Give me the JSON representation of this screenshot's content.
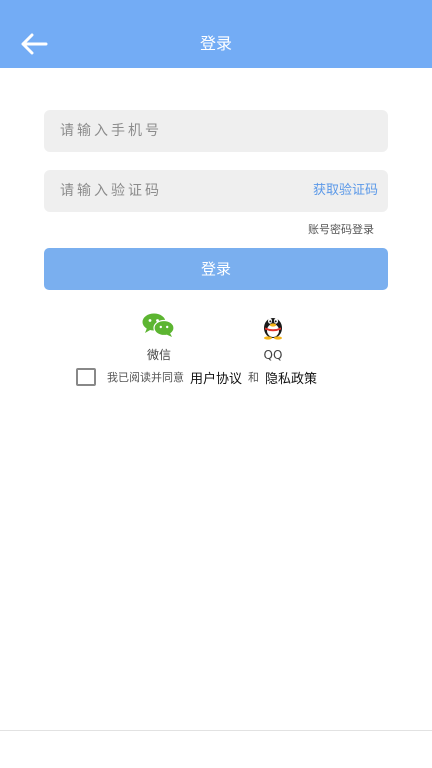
{
  "header": {
    "title": "登录",
    "back_icon": "arrow-left-icon"
  },
  "form": {
    "phone_placeholder": "请输入手机号",
    "code_placeholder": "请输入验证码",
    "get_code_label": "获取验证码",
    "password_login_label": "账号密码登录",
    "login_button_label": "登录"
  },
  "social": {
    "wechat_label": "微信",
    "qq_label": "QQ"
  },
  "agreement": {
    "checked": false,
    "prefix": "我已阅读并同意",
    "user_agreement": "用户协议",
    "and": "和",
    "privacy_policy": "隐私政策"
  },
  "colors": {
    "header_bg": "#73acf5",
    "primary_button": "#7aafef",
    "link_blue": "#5a98e8",
    "field_bg": "#efefef",
    "wechat_green": "#5cb531"
  }
}
